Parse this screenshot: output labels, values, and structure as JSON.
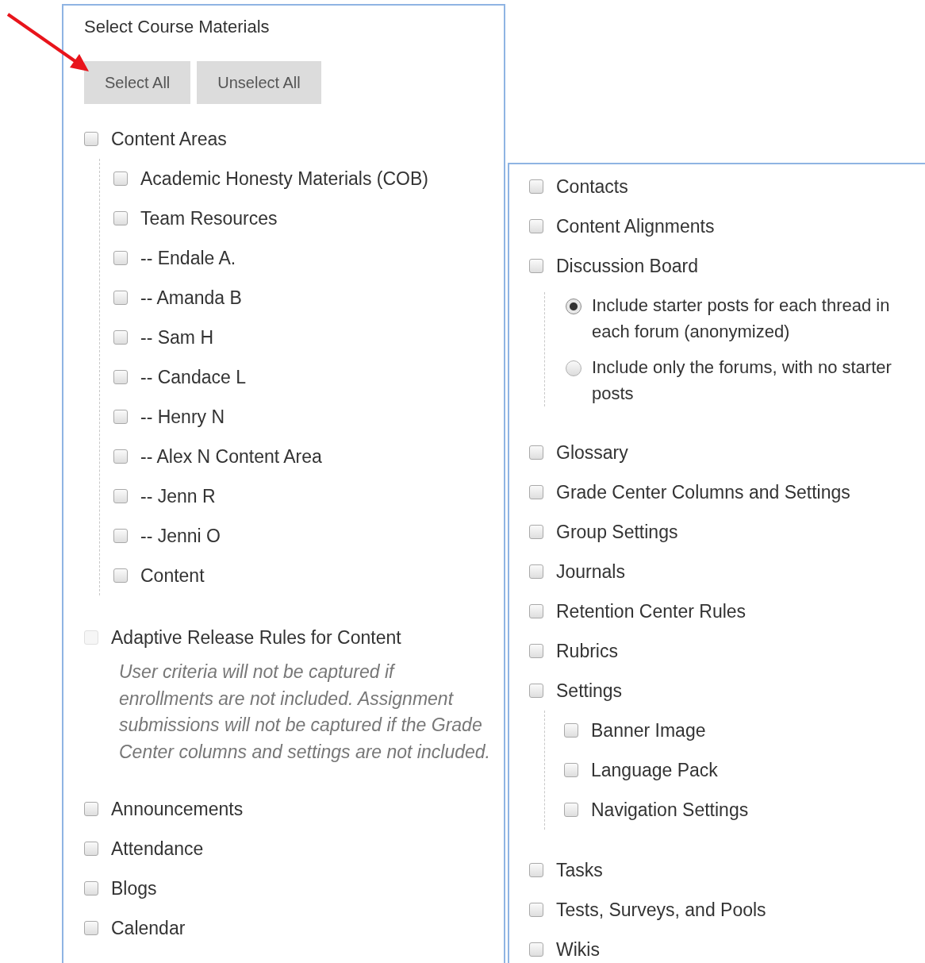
{
  "left_panel": {
    "title": "Select Course Materials",
    "buttons": [
      "Select All",
      "Unselect All"
    ],
    "items": [
      {
        "label": "Content Areas",
        "checked": false,
        "disabled": false,
        "children": [
          {
            "label": "Academic Honesty Materials (COB)",
            "checked": false
          },
          {
            "label": "Team Resources",
            "checked": false
          },
          {
            "label": "-- Endale A.",
            "checked": false
          },
          {
            "label": "-- Amanda B",
            "checked": false
          },
          {
            "label": "-- Sam H",
            "checked": false
          },
          {
            "label": "-- Candace L",
            "checked": false
          },
          {
            "label": "-- Henry N",
            "checked": false
          },
          {
            "label": "-- Alex N Content Area",
            "checked": false
          },
          {
            "label": "-- Jenn R",
            "checked": false
          },
          {
            "label": "-- Jenni O",
            "checked": false
          },
          {
            "label": "Content",
            "checked": false
          }
        ]
      },
      {
        "label": "Adaptive Release Rules for Content",
        "checked": false,
        "disabled": true,
        "note": "User criteria will not be captured if enrollments are not included. Assignment submissions will not be captured if the Grade Center columns and settings are not included."
      },
      {
        "label": "Announcements",
        "checked": false,
        "disabled": false
      },
      {
        "label": "Attendance",
        "checked": false,
        "disabled": false
      },
      {
        "label": "Blogs",
        "checked": false,
        "disabled": false
      },
      {
        "label": "Calendar",
        "checked": false,
        "disabled": false
      }
    ]
  },
  "right_panel": {
    "items": [
      {
        "label": "Contacts",
        "checked": false
      },
      {
        "label": "Content Alignments",
        "checked": false
      },
      {
        "label": "Discussion Board",
        "checked": false,
        "options": [
          {
            "label": "Include starter posts for each thread in each forum (anonymized)",
            "selected": true
          },
          {
            "label": "Include only the forums, with no starter posts",
            "selected": false
          }
        ]
      },
      {
        "label": "Glossary",
        "checked": false
      },
      {
        "label": "Grade Center Columns and Settings",
        "checked": false
      },
      {
        "label": "Group Settings",
        "checked": false
      },
      {
        "label": "Journals",
        "checked": false
      },
      {
        "label": "Retention Center Rules",
        "checked": false
      },
      {
        "label": "Rubrics",
        "checked": false
      },
      {
        "label": "Settings",
        "checked": false,
        "children": [
          {
            "label": "Banner Image",
            "checked": false
          },
          {
            "label": "Language Pack",
            "checked": false
          },
          {
            "label": "Navigation Settings",
            "checked": false
          }
        ]
      },
      {
        "label": "Tasks",
        "checked": false
      },
      {
        "label": "Tests, Surveys, and Pools",
        "checked": false
      },
      {
        "label": "Wikis",
        "checked": false
      }
    ]
  }
}
